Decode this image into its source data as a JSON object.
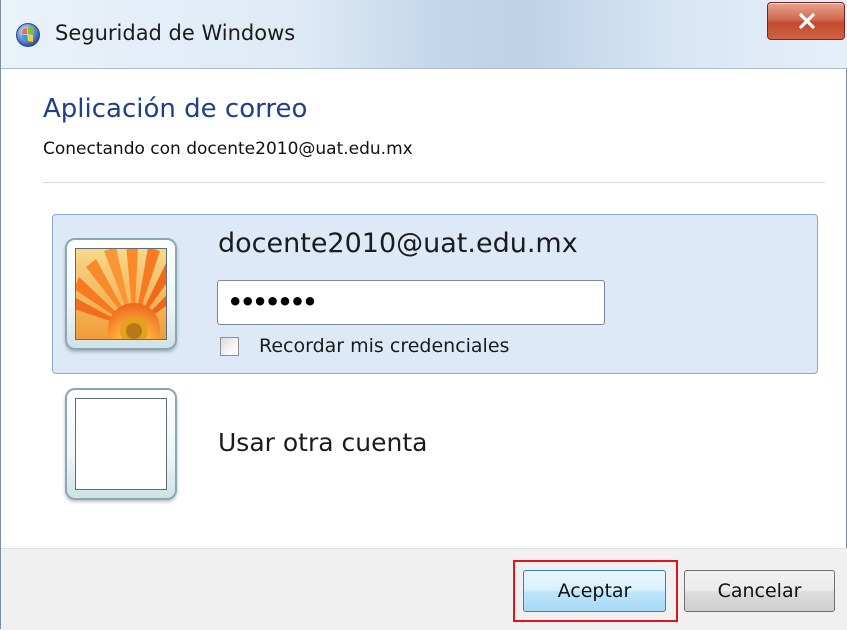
{
  "window": {
    "title": "Seguridad de Windows",
    "icon": "windows-security-icon",
    "close_icon": "close-icon"
  },
  "main": {
    "heading": "Aplicación de correo",
    "subheading": "Conectando con docente2010@uat.edu.mx"
  },
  "accounts": [
    {
      "email": "docente2010@uat.edu.mx",
      "avatar": "flower-avatar-icon",
      "password_masked": "•••••••",
      "remember_label": "Recordar mis credenciales",
      "remember_checked": false,
      "selected": true
    },
    {
      "label": "Usar otra cuenta",
      "avatar": "blank-avatar-icon",
      "selected": false
    }
  ],
  "footer": {
    "accept_label": "Aceptar",
    "cancel_label": "Cancelar",
    "accept_highlight_color": "#e0141e"
  },
  "colors": {
    "heading": "#1e3f8a",
    "selected_tile_bg": "#dde9f7",
    "selected_tile_border": "#86a9d4",
    "close_button": "#c24a2d"
  }
}
